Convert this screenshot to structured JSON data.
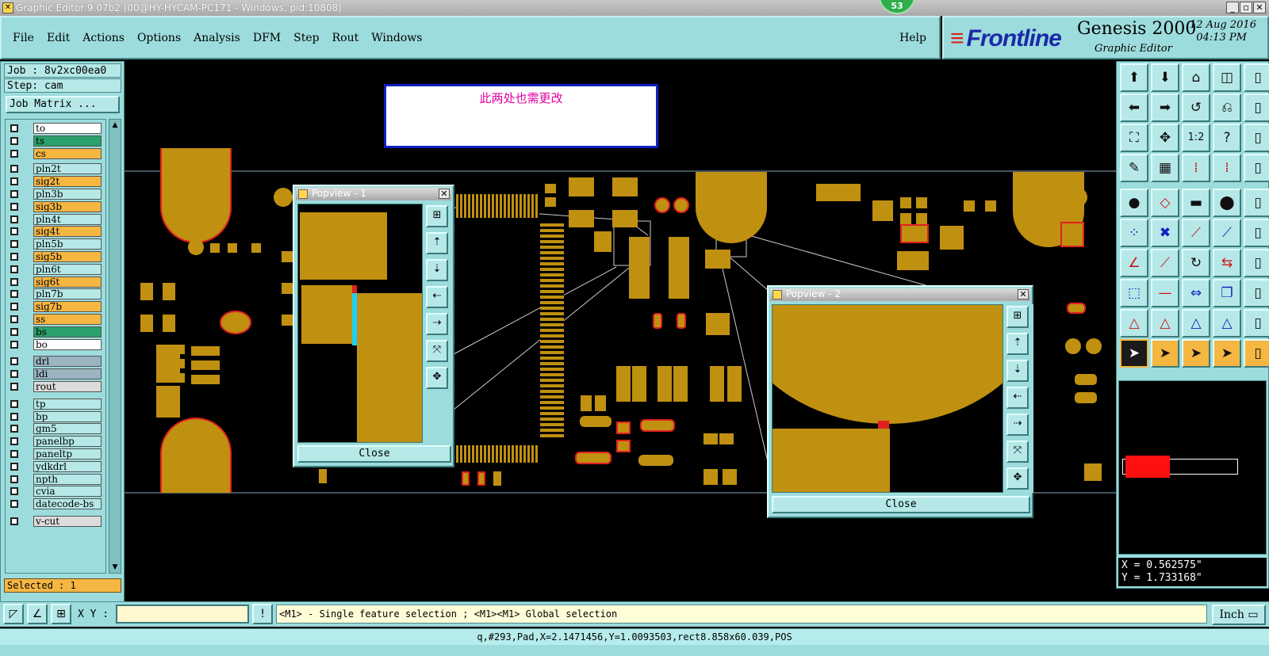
{
  "window": {
    "title": "Graphic Editor 9.07b2 (00@HY-HYCAM-PC171 - Windows, pid:10808)",
    "badge": "53"
  },
  "menu": {
    "items": [
      "File",
      "Edit",
      "Actions",
      "Options",
      "Analysis",
      "DFM",
      "Step",
      "Rout",
      "Windows"
    ],
    "help": "Help"
  },
  "brand": {
    "logo": "Frontline",
    "product": "Genesis 2000",
    "subtitle": "Graphic Editor",
    "date": "12 Aug 2016",
    "time": "04:13 PM"
  },
  "job": {
    "job_label": "Job : 8v2xc00ea0",
    "step_label": "Step: cam",
    "matrix_button": "Job Matrix ..."
  },
  "layers": [
    {
      "name": "to",
      "color": "#ffffff"
    },
    {
      "name": "ts",
      "color": "#2aa06a"
    },
    {
      "name": "cs",
      "color": "#f5b642"
    },
    {
      "name": "pln2t",
      "color": "#b6e8e8"
    },
    {
      "name": "sig2t",
      "color": "#f5b642"
    },
    {
      "name": "pln3b",
      "color": "#b6e8e8"
    },
    {
      "name": "sig3b",
      "color": "#f5b642"
    },
    {
      "name": "pln4t",
      "color": "#b6e8e8"
    },
    {
      "name": "sig4t",
      "color": "#f5b642"
    },
    {
      "name": "pln5b",
      "color": "#b6e8e8"
    },
    {
      "name": "sig5b",
      "color": "#f5b642"
    },
    {
      "name": "pln6t",
      "color": "#b6e8e8"
    },
    {
      "name": "sig6t",
      "color": "#f5b642"
    },
    {
      "name": "pln7b",
      "color": "#b6e8e8"
    },
    {
      "name": "sig7b",
      "color": "#f5b642"
    },
    {
      "name": "ss",
      "color": "#f5b642"
    },
    {
      "name": "bs",
      "color": "#2aa06a"
    },
    {
      "name": "bo",
      "color": "#ffffff"
    },
    {
      "name": "drl",
      "color": "#9ab4c0"
    },
    {
      "name": "ldi",
      "color": "#9ab4c0"
    },
    {
      "name": "rout",
      "color": "#dcdcdc"
    },
    {
      "name": "tp",
      "color": "#b6e8e8"
    },
    {
      "name": "bp",
      "color": "#b6e8e8"
    },
    {
      "name": "gm5",
      "color": "#b6e8e8"
    },
    {
      "name": "panelbp",
      "color": "#b6e8e8"
    },
    {
      "name": "paneltp",
      "color": "#b6e8e8"
    },
    {
      "name": "ydkdrl",
      "color": "#b6e8e8"
    },
    {
      "name": "npth",
      "color": "#b6e8e8"
    },
    {
      "name": "cvia",
      "color": "#b6e8e8"
    },
    {
      "name": "datecode-bs",
      "color": "#b6e8e8"
    },
    {
      "name": "v-cut",
      "color": "#dcdcdc"
    }
  ],
  "selected": "Selected : 1",
  "annotation": {
    "text": "此两处也需更改"
  },
  "popview1": {
    "title": "Popview - 1",
    "close": "Close"
  },
  "popview2": {
    "title": "Popview - 2",
    "close": "Close"
  },
  "coords": {
    "x": "X = 0.562575\"",
    "y": "Y = 1.733168\""
  },
  "bottom": {
    "xy_label": "X Y :",
    "xy_value": "",
    "message": "<M1> - Single feature selection ; <M1><M1> Global selection",
    "unit": "Inch"
  },
  "status": "q,#293,Pad,X=2.1471456,Y=1.0093503,rect8.858x60.039,POS",
  "colors": {
    "copper": "#c09010",
    "panel": "#9ddcdc",
    "highlight": "#e02020",
    "annotation_border": "#1020c0",
    "annotation_text": "#e000a0"
  }
}
